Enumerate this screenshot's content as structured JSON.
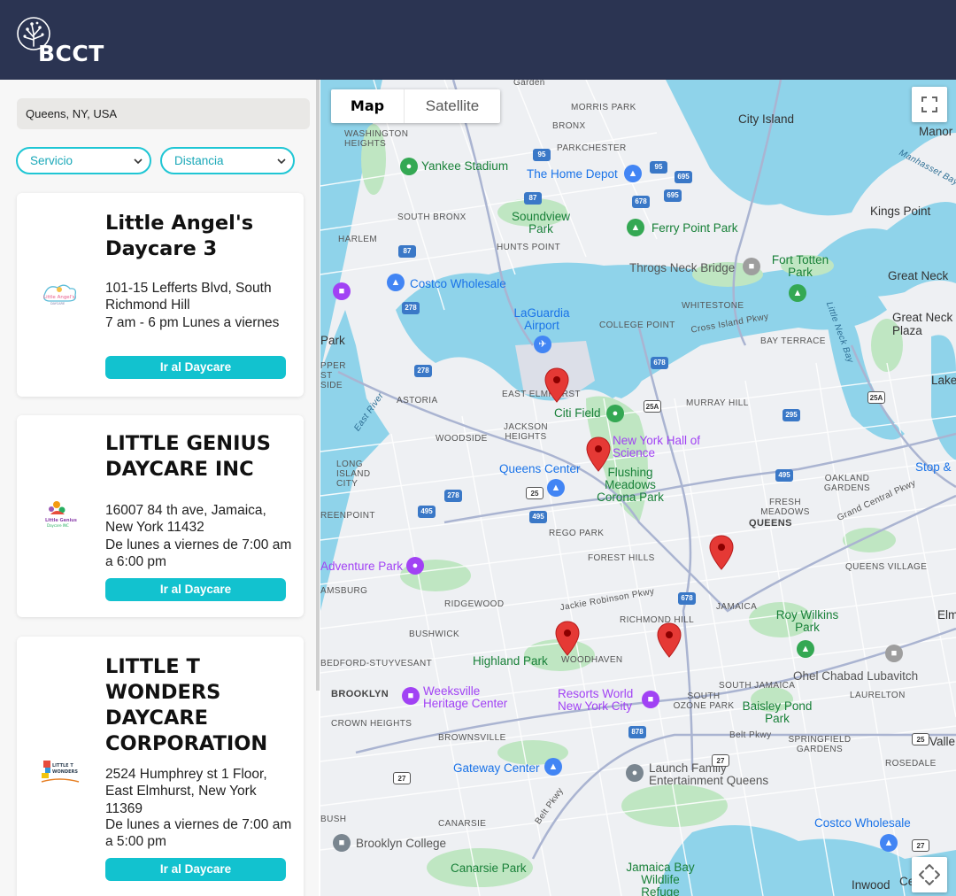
{
  "header": {
    "brand": "BCCT",
    "brand_color": "#2b3452"
  },
  "search": {
    "value": "Queens, NY, USA"
  },
  "filters": {
    "service_label": "Servicio",
    "distance_label": "Distancia"
  },
  "cards": [
    {
      "title": "Little Angel's Daycare 3",
      "address": "101-15 Lefferts Blvd, South Richmond Hill",
      "hours": "7 am - 6 pm Lunes a viernes",
      "button": "Ir al Daycare",
      "logo_icon": "little-angels-logo"
    },
    {
      "title": "LITTLE GENIUS DAYCARE INC",
      "address": "16007 84 th ave, Jamaica, New York 11432",
      "hours": "De lunes a viernes de 7:00 am a 6:00 pm",
      "button": "Ir al Daycare",
      "logo_icon": "little-genius-logo"
    },
    {
      "title": "LITTLE T WONDERS DAYCARE CORPORATION",
      "address": "2524 Humphrey st 1 Floor, East Elmhurst, New York 11369",
      "hours": "De lunes a viernes de 7:00 am a 5:00 pm",
      "button": "Ir al Daycare",
      "logo_icon": "little-t-wonders-logo"
    }
  ],
  "map": {
    "type_options": [
      "Map",
      "Satellite"
    ],
    "selected_type": "Map",
    "labels": {
      "garden": "Garden",
      "morris_park": "MORRIS PARK",
      "city_island": "City Island",
      "manor": "Manor",
      "washington_heights": "WASHINGTON HEIGHTS",
      "bronx": "BRONX",
      "parkchester": "PARKCHESTER",
      "yankee_stadium": "Yankee Stadium",
      "home_depot": "The Home Depot",
      "manhasset_bay": "Manhasset Bay",
      "south_bronx": "SOUTH BRONX",
      "soundview_park": "Soundview Park",
      "ferry_point_park": "Ferry Point Park",
      "kings_point": "Kings Point",
      "harlem": "HARLEM",
      "hunts_point": "HUNTS POINT",
      "throgs_neck": "Throgs Neck Bridge",
      "fort_totten": "Fort Totten Park",
      "great_neck": "Great Neck",
      "costco_1": "Costco Wholesale",
      "whitestone": "WHITESTONE",
      "great_neck_plaza": "Great Neck Plaza",
      "laguardia": "LaGuardia Airport",
      "college_point": "COLLEGE POINT",
      "cross_island": "Cross Island Pkwy",
      "bay_terrace": "BAY TERRACE",
      "park_left": "Park",
      "upper_east": "PPER ST SIDE",
      "little_neck_bay": "Little Neck Bay",
      "lake": "Lake",
      "east_river": "East River",
      "east_elmhurst": "EAST ELMHURST",
      "astoria": "ASTORIA",
      "citi_field": "Citi Field",
      "murray_hill": "MURRAY HILL",
      "jackson_heights": "JACKSON HEIGHTS",
      "ny_hall_science": "New York Hall of Science",
      "woodside": "WOODSIDE",
      "long_island_city": "LONG ISLAND CITY",
      "queens_center": "Queens Center",
      "flushing_meadows": "Flushing Meadows Corona Park",
      "oakland_gardens": "OAKLAND GARDENS",
      "stop_shop": "Stop &",
      "greenpoint": "REENPOINT",
      "fresh_meadows": "FRESH MEADOWS",
      "queens": "QUEENS",
      "grand_central": "Grand Central Pkwy",
      "rego_park": "REGO PARK",
      "adventure_park": "Adventure Park",
      "forest_hills": "FOREST HILLS",
      "queens_village": "QUEENS VILLAGE",
      "williamsburg": "AMSBURG",
      "ridgewood": "RIDGEWOOD",
      "jackie_robinson": "Jackie Robinson Pkwy",
      "jamaica": "JAMAICA",
      "elm": "Elm",
      "richmond_hill": "RICHMOND HILL",
      "roy_wilkins": "Roy Wilkins Park",
      "bushwick": "BUSHWICK",
      "woodhaven": "WOODHAVEN",
      "highland_park": "Highland Park",
      "ohel_chabad": "Ohel Chabad Lubavitch",
      "bed_stuy": "BEDFORD-STUYVESANT",
      "brooklyn": "BROOKLYN",
      "weeksville": "Weeksville Heritage Center",
      "resorts_world": "Resorts World New York City",
      "south_jamaica": "SOUTH JAMAICA",
      "south_ozone_park": "SOUTH OZONE PARK",
      "laurelton": "LAURELTON",
      "baisley_pond": "Baisley Pond Park",
      "crown_heights": "CROWN HEIGHTS",
      "brownsville": "BROWNSVILLE",
      "belt_pkwy": "Belt Pkwy",
      "springfield_gardens": "SPRINGFIELD GARDENS",
      "valley": "Valle",
      "gateway_center": "Gateway Center",
      "launch_family": "Launch Family Entertainment Queens",
      "rosedale": "ROSEDALE",
      "belt_pkwy_2": "Belt Pkwy",
      "canarsie": "CANARSIE",
      "costco_2": "Costco Wholesale",
      "bush": "BUSH",
      "brooklyn_college": "Brooklyn College",
      "canarsie_park": "Canarsie Park",
      "jamaica_bay": "Jamaica Bay Wildlife Refuge",
      "inwood": "Inwood",
      "cedarhurst": "Ce"
    },
    "shields": [
      "87",
      "95",
      "95",
      "695",
      "678",
      "695",
      "87",
      "278",
      "678",
      "278",
      "25A",
      "295",
      "25A",
      "278",
      "25",
      "495",
      "495",
      "678",
      "495",
      "25",
      "27",
      "27",
      "27",
      "878",
      "25"
    ]
  }
}
